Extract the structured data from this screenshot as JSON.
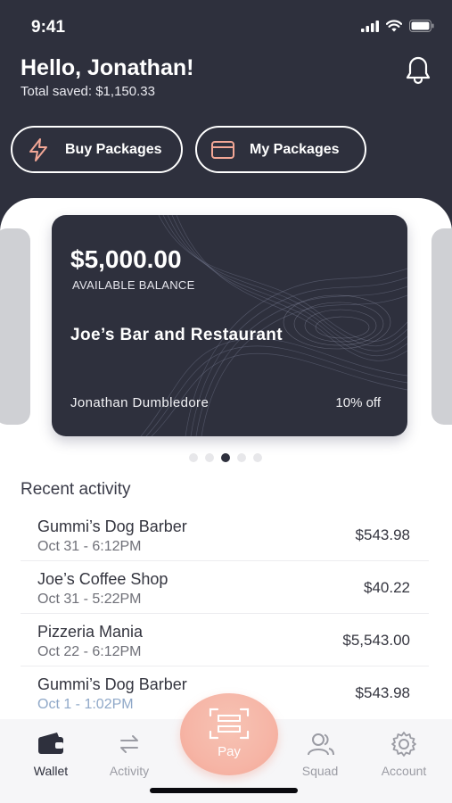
{
  "status_bar": {
    "time": "9:41"
  },
  "header": {
    "greeting": "Hello, Jonathan!",
    "total_saved": "Total saved: $1,150.33"
  },
  "actions": {
    "buy_packages": "Buy Packages",
    "my_packages": "My Packages"
  },
  "card": {
    "balance": "$5,000.00",
    "balance_label": "AVAILABLE BALANCE",
    "merchant": "Joe’s Bar and Restaurant",
    "holder": "Jonathan Dumbledore",
    "discount": "10% off",
    "pagination_total": 5,
    "pagination_active": 3
  },
  "recent_activity": {
    "title": "Recent activity",
    "items": [
      {
        "name": "Gummi’s Dog Barber",
        "date": "Oct 31 - 6:12PM",
        "amount": "$543.98"
      },
      {
        "name": "Joe’s Coffee Shop",
        "date": "Oct 31 - 5:22PM",
        "amount": "$40.22"
      },
      {
        "name": "Pizzeria Mania",
        "date": "Oct 22 - 6:12PM",
        "amount": "$5,543.00"
      },
      {
        "name": "Gummi’s Dog Barber",
        "date": "Oct 1 - 1:02PM",
        "amount": "$543.98"
      }
    ]
  },
  "tabbar": {
    "wallet": "Wallet",
    "activity": "Activity",
    "pay": "Pay",
    "squad": "Squad",
    "account": "Account",
    "active_tab": "Wallet"
  },
  "colors": {
    "dark_navy": "#2e303d",
    "accent_coral": "#f3a796",
    "inactive_tab": "#9b9ca4"
  },
  "icons": {
    "signal": "cellular-signal-icon",
    "wifi": "wifi-icon",
    "battery": "battery-icon",
    "bell": "bell-icon",
    "buy": "lightning-icon",
    "my_packages": "credit-card-icon",
    "wallet": "wallet-icon",
    "activity": "swap-arrows-icon",
    "pay": "scan-face-icon",
    "squad": "users-icon",
    "account": "gear-icon"
  }
}
